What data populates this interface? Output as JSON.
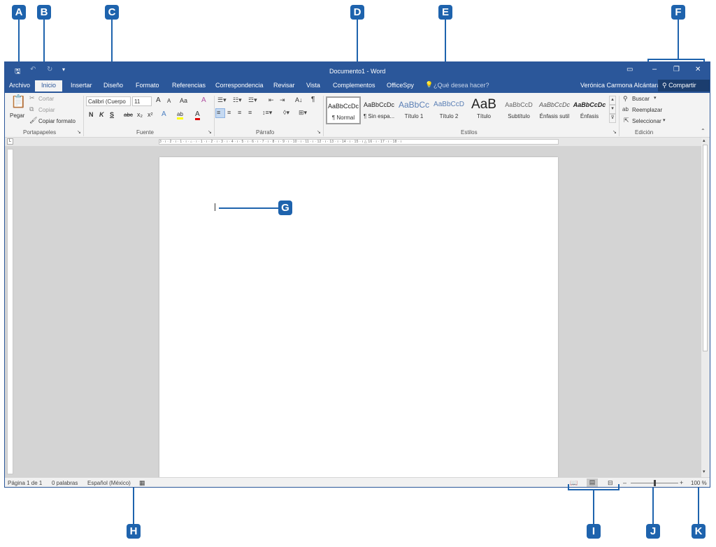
{
  "window": {
    "title": "Documento1 - Word",
    "user": "Verónica Carmona Alcántara",
    "share_label": "Compartir",
    "controls": {
      "ribbon_display": "▭",
      "minimize": "–",
      "restore": "❐",
      "close": "✕"
    }
  },
  "quick_access": {
    "save": "🖫",
    "undo": "↶",
    "redo": "↻",
    "customize": "▾"
  },
  "tabs": [
    {
      "label": "Archivo"
    },
    {
      "label": "Inicio"
    },
    {
      "label": "Insertar"
    },
    {
      "label": "Diseño"
    },
    {
      "label": "Formato"
    },
    {
      "label": "Referencias"
    },
    {
      "label": "Correspondencia"
    },
    {
      "label": "Revisar"
    },
    {
      "label": "Vista"
    },
    {
      "label": "Complementos"
    },
    {
      "label": "OfficeSpy"
    }
  ],
  "tell_me": {
    "icon": "lightbulb-icon",
    "placeholder": "¿Qué desea hacer?"
  },
  "ribbon": {
    "clipboard": {
      "paste": "Pegar",
      "cut": "Cortar",
      "copy": "Copiar",
      "format_painter": "Copiar formato",
      "group": "Portapapeles"
    },
    "font": {
      "font_name": "Calibri (Cuerpo",
      "font_size": "11",
      "grow": "A",
      "shrink": "A",
      "case": "Aa",
      "clear": "A",
      "bold": "N",
      "italic": "K",
      "underline": "S",
      "strike": "abc",
      "subscript": "x₂",
      "superscript": "x²",
      "effects": "A",
      "highlight": "ab",
      "font_color": "A",
      "group": "Fuente"
    },
    "paragraph": {
      "pilcrow": "¶",
      "sort": "A↓",
      "group": "Párrafo"
    },
    "styles": {
      "group": "Estilos",
      "items": [
        {
          "preview": "AaBbCcDc",
          "name": "¶ Normal"
        },
        {
          "preview": "AaBbCcDc",
          "name": "¶ Sin espa..."
        },
        {
          "preview": "AaBbCc",
          "name": "Título 1"
        },
        {
          "preview": "AaBbCcD",
          "name": "Título 2"
        },
        {
          "preview": "AaB",
          "name": "Título"
        },
        {
          "preview": "AaBbCcD",
          "name": "Subtítulo"
        },
        {
          "preview": "AaBbCcDc",
          "name": "Énfasis sutil"
        },
        {
          "preview": "AaBbCcDc",
          "name": "Énfasis"
        }
      ]
    },
    "editing": {
      "find": "Buscar",
      "replace": "Reemplazar",
      "select": "Seleccionar",
      "group": "Edición"
    }
  },
  "ruler": {
    "text": "3 · ı · 2 · ı · 1 · ı · ⌂ · ı · 1 · ı · 2 · ı · 3 · ı · 4 · ı · 5 · ı · 6 · ı · 7 · ı · 8 · ı · 9 · ı · 10 · ı · 11 · ı · 12 · ı · 13 · ı · 14 · ı · 15 · ı △ 16 · ı · 17 · ı · 18 · ı"
  },
  "statusbar": {
    "page": "Página 1 de 1",
    "words": "0 palabras",
    "language": "Español (México)",
    "zoom_minus": "–",
    "zoom_plus": "+",
    "zoom": "100 %"
  },
  "callouts": {
    "A": "A",
    "B": "B",
    "C": "C",
    "D": "D",
    "E": "E",
    "F": "F",
    "G": "G",
    "H": "H",
    "I": "I",
    "J": "J",
    "K": "K"
  },
  "colors": {
    "accent": "#2b579a",
    "callout": "#1e63ad"
  }
}
